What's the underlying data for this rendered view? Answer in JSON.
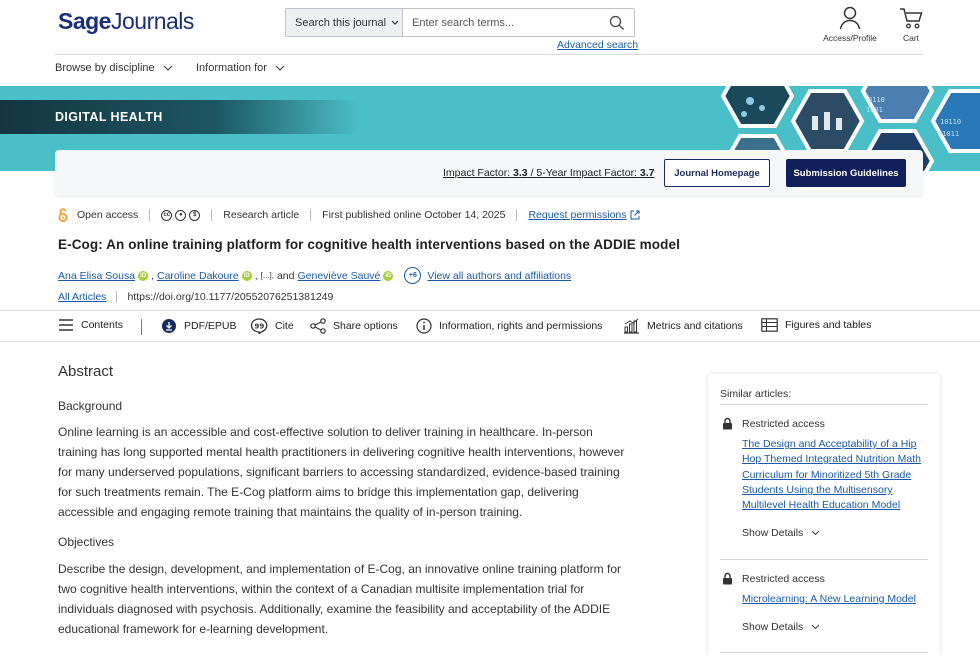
{
  "header": {
    "logo_bold": "Sage",
    "logo_regular": "Journals",
    "search_scope": "Search this journal",
    "search_placeholder": "Enter search terms...",
    "advanced_search": "Advanced search",
    "profile_label": "Access/Profile",
    "cart_label": "Cart",
    "nav": [
      "Browse by discipline",
      "Information for"
    ]
  },
  "banner": {
    "journal_name": "DIGITAL HEALTH",
    "impact_factor_label": "Impact Factor:",
    "impact_factor": "3.3",
    "five_year_label": "5-Year Impact Factor:",
    "five_year": "3.7",
    "journal_homepage": "Journal Homepage",
    "submission_guidelines": "Submission Guidelines"
  },
  "article": {
    "access": "Open access",
    "type": "Research article",
    "published": "First published online October 14, 2025",
    "request_permissions": "Request permissions",
    "title": "E-Cog: An online training platform for cognitive health interventions based on the ADDIE model",
    "authors": [
      "Ana Elisa Sousa",
      "Caroline Dakoure",
      "Geneviève Sauvé"
    ],
    "author_ellipsis": "[...],",
    "author_and": "and",
    "more_authors": "+6",
    "view_all": "View all authors and affiliations",
    "all_articles": "All Articles",
    "doi": "https://doi.org/10.1177/20552076251381249"
  },
  "toolbar": {
    "contents": "Contents",
    "pdf": "PDF/EPUB",
    "cite": "Cite",
    "share": "Share options",
    "info": "Information, rights and permissions",
    "metrics": "Metrics and citations",
    "figures": "Figures and tables"
  },
  "abstract": {
    "heading": "Abstract",
    "background_heading": "Background",
    "background_lines": [
      "Online learning is an accessible and cost-effective solution to deliver training in healthcare. In-person",
      "training has long supported mental health practitioners in delivering cognitive health interventions, however",
      "for many underserved populations, significant barriers to accessing standardized, evidence-based training",
      "for such treatments remain. The E-Cog platform aims to bridge this implementation gap, delivering",
      "accessible and engaging remote training that maintains the quality of in-person training."
    ],
    "objectives_heading": "Objectives",
    "objectives_lines": [
      "Describe the design, development, and implementation of E-Cog, an innovative online training platform for",
      "two cognitive health interventions, within the context of a Canadian multisite implementation trial for",
      "individuals diagnosed with psychosis. Additionally, examine the feasibility and acceptability of the ADDIE",
      "educational framework for e-learning development."
    ]
  },
  "sidebar": {
    "heading": "Similar articles:",
    "items": [
      {
        "access": "Restricted access",
        "title_lines": [
          "The Design and Acceptability of a Hip",
          "Hop Themed Integrated Nutrition Math",
          "Curriculum for Minoritized 5th Grade",
          "Students Using the Multisensory",
          "Multilevel Health Education Model"
        ],
        "show_details": "Show Details"
      },
      {
        "access": "Restricted access",
        "title_lines": [
          "Microlearning: A New Learning Model"
        ],
        "show_details": "Show Details"
      }
    ]
  },
  "colors": {
    "brand_navy": "#1a2f7a",
    "banner_teal": "#4bbfc8",
    "link_blue": "#1a5aa7",
    "button_navy": "#0f1f5a",
    "open_access_orange": "#f7931e",
    "orcid_green": "#a6ce39"
  }
}
